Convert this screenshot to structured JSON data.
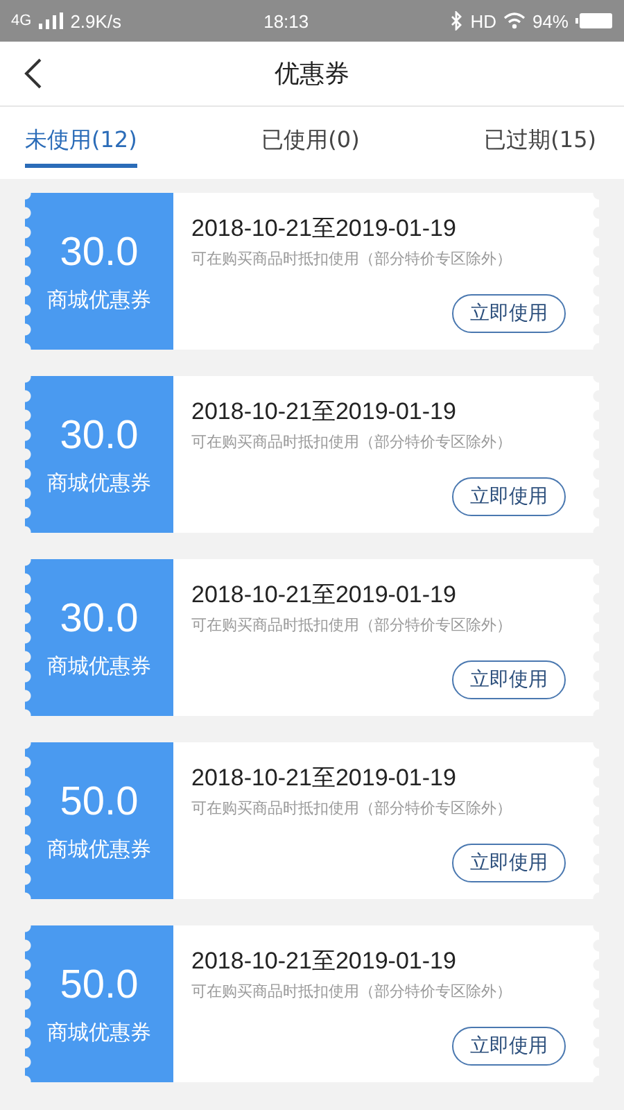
{
  "status_bar": {
    "network": "4G",
    "speed": "2.9K/s",
    "time": "18:13",
    "hd": "HD",
    "battery": "94%"
  },
  "header": {
    "title": "优惠券"
  },
  "tabs": [
    {
      "label": "未使用(12)",
      "selected": true
    },
    {
      "label": "已使用(0)",
      "selected": false
    },
    {
      "label": "已过期(15)",
      "selected": false
    }
  ],
  "coupons": [
    {
      "amount": "30.0",
      "type": "商城优惠券",
      "period": "2018-10-21至2019-01-19",
      "note": "可在购买商品时抵扣使用（部分特价专区除外）",
      "action": "立即使用"
    },
    {
      "amount": "30.0",
      "type": "商城优惠券",
      "period": "2018-10-21至2019-01-19",
      "note": "可在购买商品时抵扣使用（部分特价专区除外）",
      "action": "立即使用"
    },
    {
      "amount": "30.0",
      "type": "商城优惠券",
      "period": "2018-10-21至2019-01-19",
      "note": "可在购买商品时抵扣使用（部分特价专区除外）",
      "action": "立即使用"
    },
    {
      "amount": "50.0",
      "type": "商城优惠券",
      "period": "2018-10-21至2019-01-19",
      "note": "可在购买商品时抵扣使用（部分特价专区除外）",
      "action": "立即使用"
    },
    {
      "amount": "50.0",
      "type": "商城优惠券",
      "period": "2018-10-21至2019-01-19",
      "note": "可在购买商品时抵扣使用（部分特价专区除外）",
      "action": "立即使用"
    }
  ]
}
